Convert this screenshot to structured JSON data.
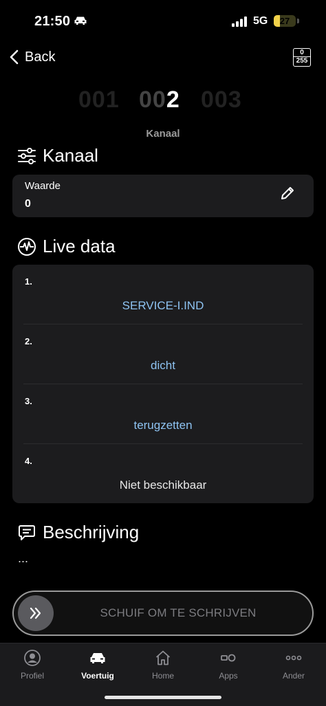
{
  "status": {
    "time": "21:50",
    "network": "5G",
    "battery": "27",
    "battery_level": 0.27
  },
  "nav": {
    "back_label": "Back",
    "range_top": "0",
    "range_bottom": "255"
  },
  "picker": {
    "prev": "001",
    "current_prefix": "00",
    "current_highlight": "2",
    "next": "003",
    "label": "Kanaal"
  },
  "kanaal": {
    "title": "Kanaal",
    "value_label": "Waarde",
    "value": "0"
  },
  "live": {
    "title": "Live data",
    "rows": [
      {
        "num": "1.",
        "value": "SERVICE-I.IND"
      },
      {
        "num": "2.",
        "value": "dicht"
      },
      {
        "num": "3.",
        "value": "terugzetten"
      },
      {
        "num": "4.",
        "value": "Niet beschikbaar"
      }
    ]
  },
  "description": {
    "title": "Beschrijving",
    "text": "..."
  },
  "slider": {
    "label": "SCHUIF OM TE SCHRIJVEN"
  },
  "tabs": [
    {
      "label": "Profiel",
      "icon": "person-icon"
    },
    {
      "label": "Voertuig",
      "icon": "car-icon",
      "active": true
    },
    {
      "label": "Home",
      "icon": "home-icon"
    },
    {
      "label": "Apps",
      "icon": "apps-icon"
    },
    {
      "label": "Ander",
      "icon": "more-icon"
    }
  ],
  "colors": {
    "accent_link": "#8ec3f2",
    "card": "#1c1c1e",
    "battery": "#f2d24a"
  }
}
